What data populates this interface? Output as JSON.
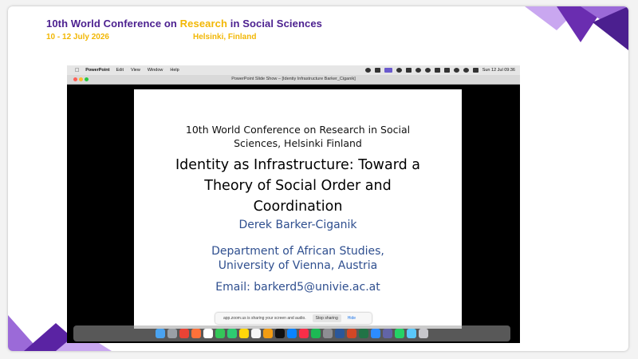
{
  "conference": {
    "title_part1": "10th World Conference on ",
    "title_highlight": "Research",
    "title_part2": " in Social Sciences",
    "dates": "10 - 12 July 2026",
    "location": "Helsinki, Finland"
  },
  "menubar": {
    "app_name": "PowerPoint",
    "items": [
      "Edit",
      "View",
      "Window",
      "Help"
    ],
    "clock": "Sun 12 Jul  09:36"
  },
  "window": {
    "title": "PowerPoint Slide Show – [Identiy Infrastructure Barker_Ciganik]"
  },
  "slide": {
    "conference_line1": "10th World Conference on Research in Social",
    "conference_line2": "Sciences, Helsinki Finland",
    "title_line1": "Identity as Infrastructure: Toward a",
    "title_line2": "Theory of Social Order and",
    "title_line3": "Coordination",
    "author": "Derek Barker-Ciganik",
    "department_line1": "Department of African Studies,",
    "department_line2": "University of Vienna, Austria",
    "email": "Email: barkerd5@univie.ac.at"
  },
  "share_bar": {
    "message": "app.zoom.us is sharing your screen and audio.",
    "stop_label": "Stop sharing",
    "hide_label": "Hide"
  },
  "colors": {
    "brand_purple": "#4b1f8f",
    "brand_yellow": "#f2b705",
    "slide_blue": "#2f4f8f"
  },
  "dock_icons": [
    "finder",
    "launchpad",
    "chrome",
    "firefox",
    "calendar",
    "messages",
    "facetime",
    "notes",
    "reminders",
    "photos",
    "tv",
    "appstore",
    "music",
    "spotify",
    "settings",
    "word",
    "powerpoint",
    "excel",
    "zoom",
    "teams",
    "whatsapp",
    "preview",
    "trash"
  ]
}
